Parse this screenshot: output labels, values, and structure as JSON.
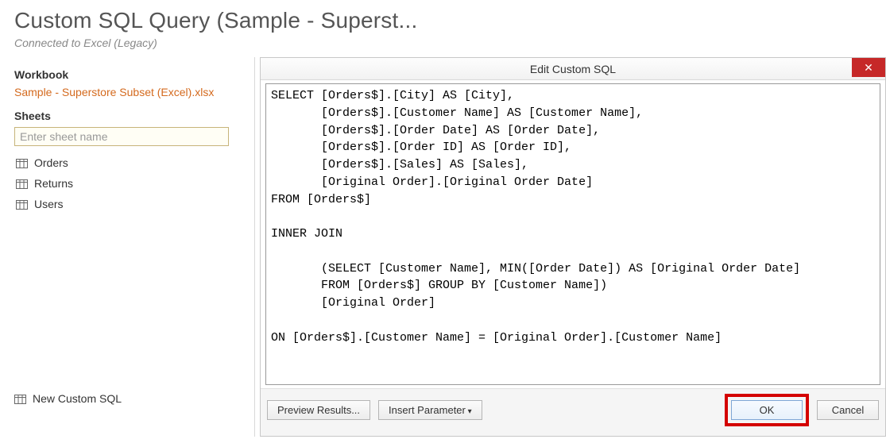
{
  "header": {
    "title": "Custom SQL Query (Sample - Superst...",
    "connected": "Connected to Excel (Legacy)"
  },
  "left": {
    "workbook_heading": "Workbook",
    "workbook_file": "Sample - Superstore Subset (Excel).xlsx",
    "sheets_heading": "Sheets",
    "sheet_placeholder": "Enter sheet name",
    "sheets": [
      {
        "label": "Orders"
      },
      {
        "label": "Returns"
      },
      {
        "label": "Users"
      }
    ],
    "new_custom_sql": "New Custom SQL"
  },
  "dialog": {
    "title": "Edit Custom SQL",
    "close_glyph": "✕",
    "sql_text": "SELECT [Orders$].[City] AS [City],\n       [Orders$].[Customer Name] AS [Customer Name],\n       [Orders$].[Order Date] AS [Order Date],\n       [Orders$].[Order ID] AS [Order ID],\n       [Orders$].[Sales] AS [Sales],\n       [Original Order].[Original Order Date]\nFROM [Orders$]\n\nINNER JOIN\n\n       (SELECT [Customer Name], MIN([Order Date]) AS [Original Order Date]\n       FROM [Orders$] GROUP BY [Customer Name])\n       [Original Order]\n\nON [Orders$].[Customer Name] = [Original Order].[Customer Name]",
    "preview_label": "Preview Results...",
    "insert_param_label": "Insert Parameter",
    "ok_label": "OK",
    "cancel_label": "Cancel"
  }
}
